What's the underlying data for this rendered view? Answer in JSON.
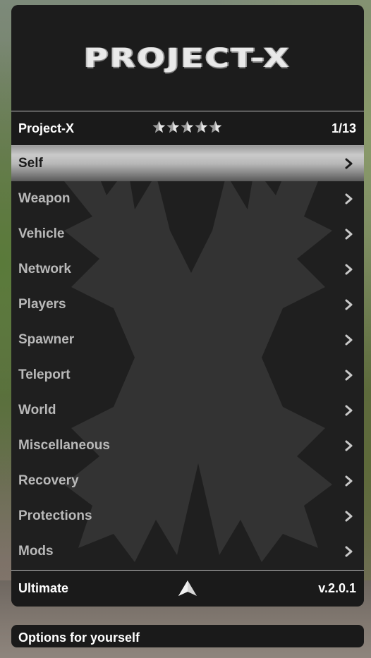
{
  "header": {
    "logo_text": "PROJECT-X"
  },
  "subheader": {
    "title": "Project-X",
    "rating": 5,
    "rating_max": 5,
    "counter": "1/13"
  },
  "menu": {
    "selected_index": 0,
    "items": [
      {
        "label": "Self",
        "icon": "chevron-right-icon"
      },
      {
        "label": "Weapon",
        "icon": "chevron-right-icon"
      },
      {
        "label": "Vehicle",
        "icon": "chevron-right-icon"
      },
      {
        "label": "Network",
        "icon": "chevron-right-icon"
      },
      {
        "label": "Players",
        "icon": "chevron-right-icon"
      },
      {
        "label": "Spawner",
        "icon": "chevron-right-icon"
      },
      {
        "label": "Teleport",
        "icon": "chevron-right-icon"
      },
      {
        "label": "World",
        "icon": "chevron-right-icon"
      },
      {
        "label": "Miscellaneous",
        "icon": "chevron-right-icon"
      },
      {
        "label": "Recovery",
        "icon": "chevron-right-icon"
      },
      {
        "label": "Protections",
        "icon": "chevron-right-icon"
      },
      {
        "label": "Mods",
        "icon": "chevron-right-icon"
      }
    ]
  },
  "footer": {
    "left": "Ultimate",
    "center_icon": "scroll-arrow-icon",
    "right": "v.2.0.1"
  },
  "description": {
    "text": "Options for yourself"
  },
  "colors": {
    "panel_bg": "#1e1e1e",
    "item_text": "#b9b9b9",
    "selected_text": "#1a1a1a",
    "header_text": "#ffffff",
    "divider": "#bfbfbf"
  }
}
